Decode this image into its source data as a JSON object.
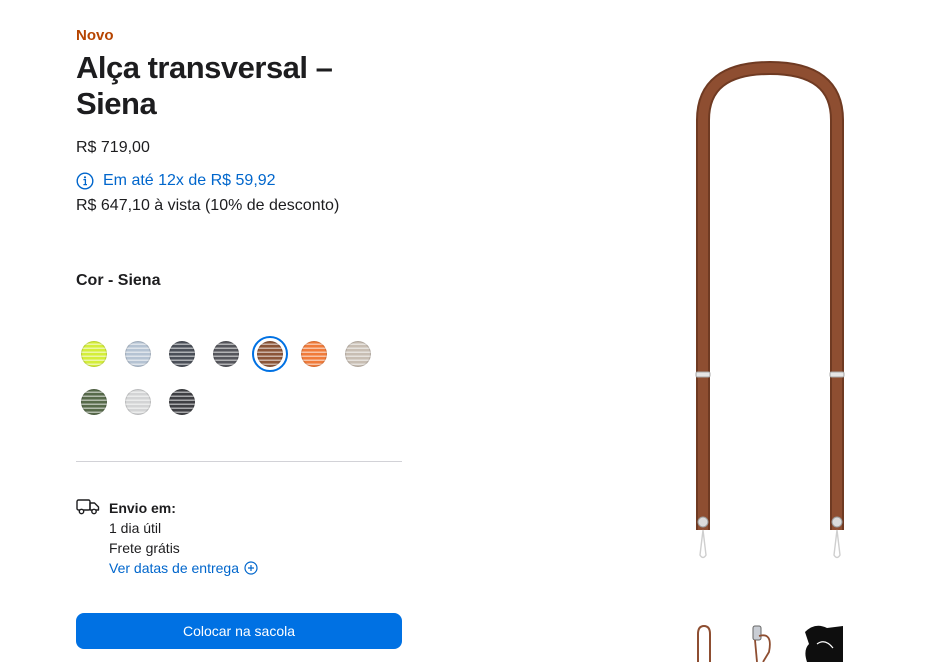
{
  "product": {
    "badge": "Novo",
    "title": "Alça transversal – Siena",
    "price": "R$ 719,00",
    "installments": "Em até 12x de R$ 59,92",
    "cash_price": "R$ 647,10 à vista (10% de desconto)"
  },
  "color": {
    "label": "Cor - Siena",
    "selected": "Siena",
    "swatches": [
      {
        "color": "#d4ee3a",
        "selected": false
      },
      {
        "color": "#b5c3d3",
        "selected": false
      },
      {
        "color": "#4a4f58",
        "selected": false
      },
      {
        "color": "#55565c",
        "selected": false
      },
      {
        "color": "#8b5538",
        "selected": true
      },
      {
        "color": "#f07b3a",
        "selected": false
      },
      {
        "color": "#c8beb3",
        "selected": false
      },
      {
        "color": "#576a4a",
        "selected": false
      },
      {
        "color": "#d3d4d5",
        "selected": false
      },
      {
        "color": "#3f4044",
        "selected": false
      }
    ]
  },
  "shipping": {
    "title": "Envio em:",
    "days": "1 dia útil",
    "free": "Frete grátis",
    "link": "Ver datas de entrega",
    "icon": "truck-icon"
  },
  "actions": {
    "add_to_bag": "Colocar na sacola"
  },
  "colors": {
    "accent": "#0071e3",
    "link": "#0066cc",
    "badge": "#b64400",
    "strap": "#8c4b2f"
  }
}
